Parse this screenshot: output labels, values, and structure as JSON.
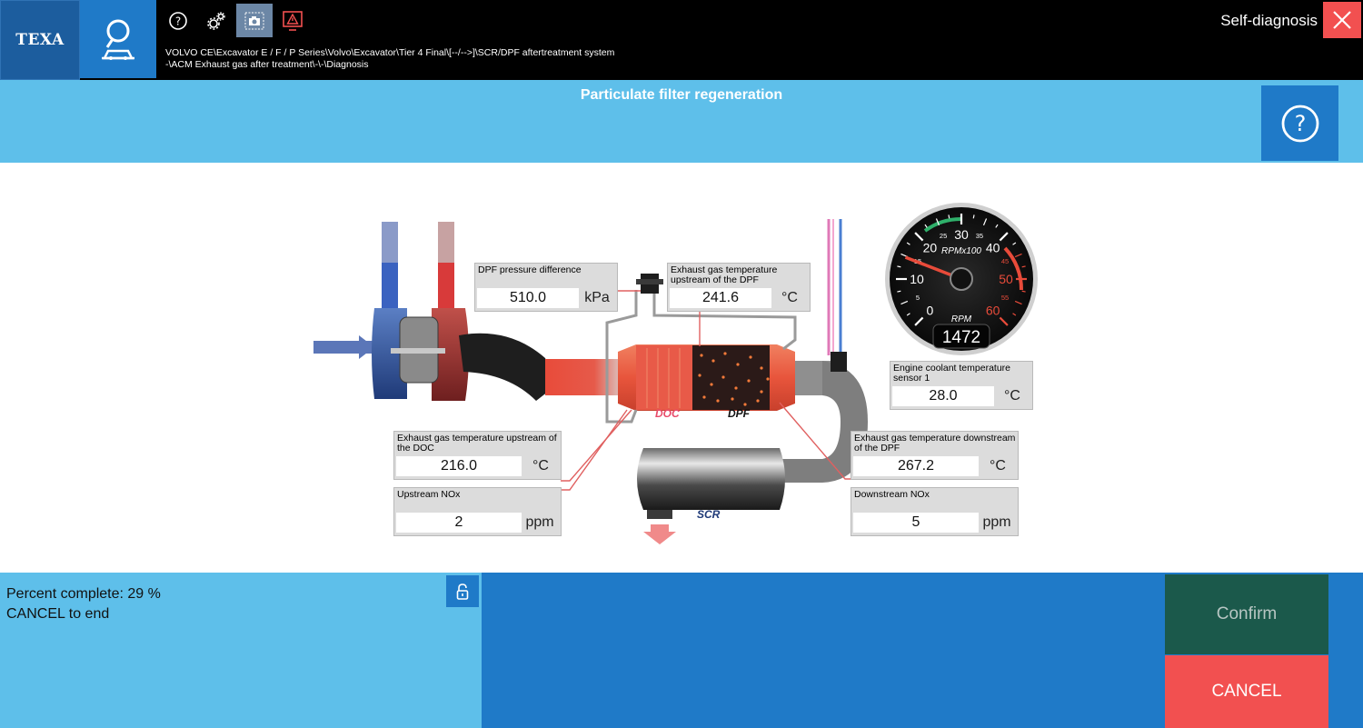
{
  "topbar": {
    "logo": "TEXA",
    "tool_icons": [
      "help-circle-icon",
      "gears-icon",
      "screenshot-icon",
      "warning-report-icon"
    ],
    "breadcrumb_line1": "VOLVO CE\\Excavator E / F / P Series\\Volvo\\Excavator\\Tier 4 Final\\[--/-->]\\SCR/DPF aftertreatment system",
    "breadcrumb_line2": "-\\ACM Exhaust gas after treatment\\-\\-\\Diagnosis",
    "app_title": "Self-diagnosis"
  },
  "header": {
    "title": "Particulate filter regeneration"
  },
  "diagram": {
    "readouts": {
      "dpf_pressure": {
        "label": "DPF pressure difference",
        "value": "510.0",
        "unit": "kPa"
      },
      "egt_upstream_dpf": {
        "label": "Exhaust gas temperature upstream  of the DPF",
        "value": "241.6",
        "unit": "°C"
      },
      "coolant_temp": {
        "label": "Engine coolant temperature sensor  1",
        "value": "28.0",
        "unit": "°C"
      },
      "egt_upstream_doc": {
        "label": "Exhaust gas temperature upstream of  the DOC",
        "value": "216.0",
        "unit": "°C"
      },
      "egt_downstream_dpf": {
        "label": "Exhaust gas temperature downstream  of the DPF",
        "value": "267.2",
        "unit": "°C"
      },
      "upstream_nox": {
        "label": "Upstream NOx",
        "value": "2",
        "unit": "ppm"
      },
      "downstream_nox": {
        "label": "Downstream NOx",
        "value": "5",
        "unit": "ppm"
      }
    },
    "tags": {
      "doc": "DOC",
      "dpf": "DPF",
      "scr": "SCR"
    },
    "gauge": {
      "unit_label": "RPMx100",
      "bottom_label": "RPM",
      "rpm_value": "1472",
      "rpm_number": 1472,
      "major_ticks": [
        "0",
        "10",
        "20",
        "30",
        "40",
        "50",
        "60"
      ],
      "minor_ticks": [
        "5",
        "15",
        "25",
        "35",
        "45",
        "55"
      ]
    },
    "colors": {
      "hot": "#e84b3a",
      "cold": "#2f63b8",
      "accent": "#1f7ac8"
    }
  },
  "status": {
    "line1": "Percent complete: 29 %",
    "line2": "CANCEL to end",
    "percent": 29
  },
  "actions": {
    "confirm": "Confirm",
    "cancel": "CANCEL"
  }
}
